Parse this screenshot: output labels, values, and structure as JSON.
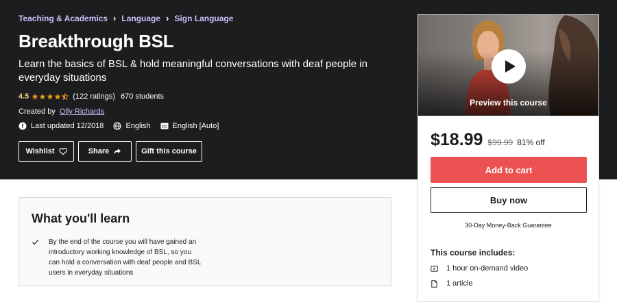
{
  "breadcrumb": {
    "items": [
      "Teaching & Academics",
      "Language",
      "Sign Language"
    ],
    "separator": "›"
  },
  "course": {
    "title": "Breakthrough BSL",
    "subtitle": "Learn the basics of BSL & hold meaningful conversations with deaf people in everyday situations",
    "rating": "4.5",
    "rating_value": 4.5,
    "rating_max": 5,
    "ratings_count": "(122 ratings)",
    "students": "670 students",
    "created_by_label": "Created by",
    "author": "Olly Richards",
    "last_updated": "Last updated 12/2018",
    "language": "English",
    "captions": "English [Auto]"
  },
  "actions": {
    "wishlist_label": "Wishlist",
    "share_label": "Share",
    "gift_label": "Gift this course"
  },
  "sidebar": {
    "preview_label": "Preview this course",
    "price": "$18.99",
    "original_price": "$99.99",
    "discount": "81% off",
    "add_to_cart_label": "Add to cart",
    "buy_now_label": "Buy now",
    "guarantee": "30-Day Money-Back Guarantee",
    "includes_title": "This course includes:",
    "includes": [
      {
        "icon": "video-icon",
        "text": "1 hour on-demand video"
      },
      {
        "icon": "article-icon",
        "text": "1 article"
      }
    ]
  },
  "learn": {
    "title": "What you'll learn",
    "items": [
      "By the end of the course you will have gained an introductory working knowledge of BSL, so you can hold a conversation with deaf people and BSL users in everyday situations"
    ]
  },
  "colors": {
    "topbar_bg": "#1c1d1f",
    "breadcrumb": "#cec0fc",
    "rating_star": "#f3ca8c",
    "cart_button": "#ec5252",
    "learn_bg": "#f7f9fa"
  }
}
